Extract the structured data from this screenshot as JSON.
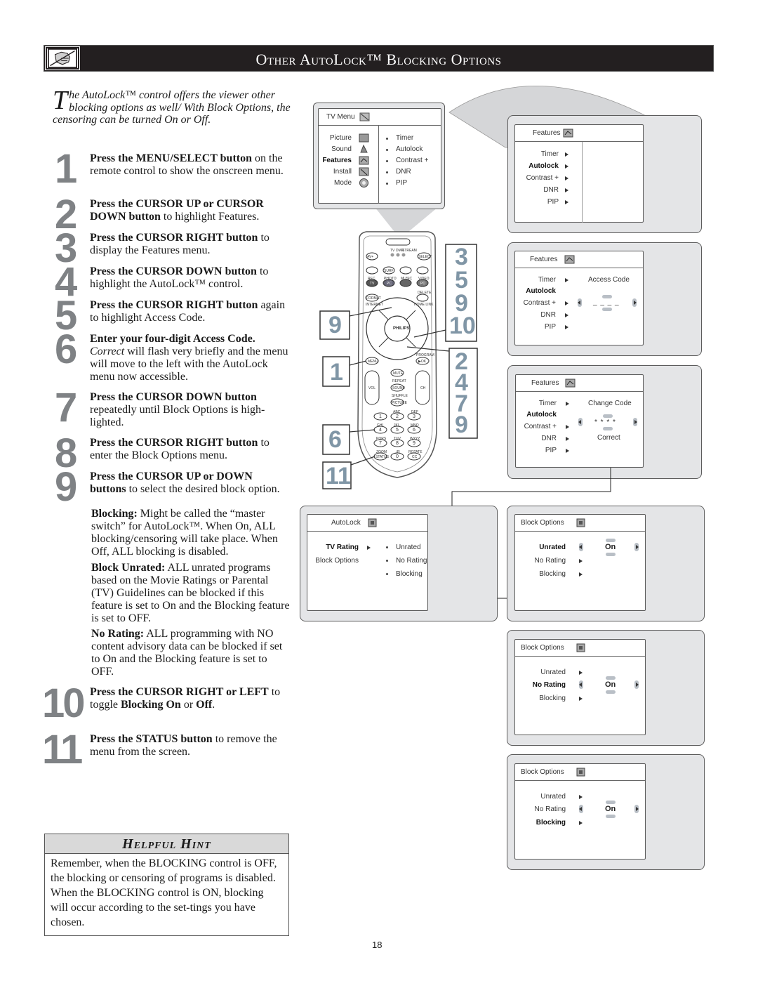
{
  "header": {
    "icon": "hand-pointing-icon",
    "title": "Other AutoLock™ Blocking Options"
  },
  "intro": {
    "dropcap": "T",
    "text": "he AutoLock™ control offers the viewer other blocking options as well/ With Block Options, the censoring can be turned On or Off."
  },
  "steps": [
    {
      "number": "1",
      "bold": "Press the MENU/SELECT button",
      "rest": " on the remote control to show the onscreen menu."
    },
    {
      "number": "2",
      "bold": "Press the CURSOR UP or CURSOR DOWN button",
      "rest": " to highlight Features."
    },
    {
      "number": "3",
      "bold": "Press the CURSOR RIGHT button",
      "rest": " to display the Features menu."
    },
    {
      "number": "4",
      "bold": "Press the CURSOR DOWN button",
      "rest": " to highlight the AutoLock™ control."
    },
    {
      "number": "5",
      "bold": "Press the CURSOR RIGHT button",
      "rest": " again to highlight Access Code."
    },
    {
      "number": "6",
      "bold": "Enter your four-digit Access Code.",
      "rest_italic": "Correct",
      "rest": " will flash very briefly and the menu will move to the left with the AutoLock menu now accessible."
    },
    {
      "number": "7",
      "bold": "Press the CURSOR DOWN button",
      "rest": " repeatedly until Block Options is high-lighted."
    },
    {
      "number": "8",
      "bold": "Press the CURSOR RIGHT button",
      "rest": " to enter the Block Options menu."
    },
    {
      "number": "9",
      "bold": "Press the CURSOR UP or DOWN buttons",
      "rest": " to select the desired block option."
    },
    {
      "number": "10",
      "bold": "Press the CURSOR RIGHT or LEFT",
      "rest": " to toggle ",
      "bold2": "Blocking On",
      "rest2": " or ",
      "bold3": "Off",
      "rest3": "."
    },
    {
      "number": "11",
      "bold": "Press the STATUS button",
      "rest": " to remove the menu from the screen."
    }
  ],
  "definitions": [
    {
      "term": "Blocking:",
      "text": " Might be called the “master switch” for AutoLock™. When On, ALL blocking/censoring will take place. When Off, ALL blocking is disabled."
    },
    {
      "term": "Block Unrated:",
      "text": " ALL unrated programs based on the Movie Ratings or Parental (TV) Guidelines can be blocked if this feature is set to On and the Blocking feature is set to OFF."
    },
    {
      "term": "No Rating:",
      "text": " ALL programming with NO content advisory data can be blocked if set to On and the Blocking feature is set to OFF."
    }
  ],
  "hint": {
    "title": "Helpful Hint",
    "text": "Remember, when the BLOCKING control is OFF, the blocking or censoring of programs is disabled. When the BLOCKING control is ON, blocking will occur according to the set-tings you have chosen."
  },
  "page_number": "18",
  "screens": {
    "tv_menu": {
      "title": "TV Menu",
      "left_items": [
        "Picture",
        "Sound",
        "Features",
        "Install",
        "Mode"
      ],
      "selected": "Features",
      "right_items": [
        "Timer",
        "Autolock",
        "Contrast +",
        "DNR",
        "PIP"
      ]
    },
    "features_1": {
      "title": "Features",
      "items": [
        "Timer",
        "Autolock",
        "Contrast +",
        "DNR",
        "PIP"
      ],
      "selected": "Autolock"
    },
    "features_2": {
      "title": "Features",
      "items": [
        "Timer",
        "Autolock",
        "Contrast +",
        "DNR",
        "PIP"
      ],
      "selected": "Autolock",
      "field_label": "Access Code",
      "field_value": "_ _ _ _"
    },
    "features_3": {
      "title": "Features",
      "items": [
        "Timer",
        "Autolock",
        "Contrast +",
        "DNR",
        "PIP"
      ],
      "selected": "Autolock",
      "field_label": "Change Code",
      "field_value": "* * * *",
      "status": "Correct"
    },
    "autolock": {
      "title": "AutoLock",
      "left_items": [
        "TV Rating",
        "Block Options"
      ],
      "selected": "TV Rating",
      "right_items": [
        "Unrated",
        "No Rating",
        "Blocking"
      ]
    },
    "block_options_1": {
      "title": "Block Options",
      "items": [
        "Unrated",
        "No Rating",
        "Blocking"
      ],
      "selected": "Unrated",
      "value": "On"
    },
    "block_options_2": {
      "title": "Block Options",
      "items": [
        "Unrated",
        "No Rating",
        "Blocking"
      ],
      "selected": "No Rating",
      "value": "On"
    },
    "block_options_3": {
      "title": "Block Options",
      "items": [
        "Unrated",
        "No Rating",
        "Blocking"
      ],
      "selected": "Blocking",
      "value": "On"
    }
  },
  "remote": {
    "brand": "PHILIPS",
    "top_labels": [
      "TV",
      "DMR",
      "STREAM"
    ],
    "buttons_row1": [
      "AV+",
      "SELECT"
    ],
    "buttons_row2_labels": [
      "▶II",
      "■",
      "I◀◀",
      "▶▶I"
    ],
    "buttons_row2": [
      "",
      "SURF",
      "",
      ""
    ],
    "buttons_row3_labels": [
      "REC",
      "PHOTO",
      "MUSIC",
      "VIDEO"
    ],
    "buttons_row3": [
      "TV",
      "PC",
      "",
      "PO"
    ],
    "format": "FORMAT",
    "internet": "INTERNET",
    "delete": "DELETE",
    "home_link": "HOME LINK",
    "menu": "MENU",
    "program": "PROGRAM",
    "ok": "▶OK",
    "mute": "MUTE",
    "repeat": "REPEAT",
    "sound": "SOUND",
    "shuffle": "SHUFFLE",
    "picture": "PICTURE",
    "vol": "VOL",
    "ch": "CH",
    "digits": [
      "1",
      "2",
      "3",
      "4",
      "5",
      "6",
      "7",
      "8",
      "9",
      "STATUS",
      "0",
      "CC"
    ],
    "digit_labels": [
      ".",
      "ABC",
      "DEF",
      "GHI",
      "JKL",
      "MNO",
      "PQRS",
      "TUV",
      "WXYZ",
      "ZOOM",
      "_/R",
      "ROTATE"
    ],
    "callouts": {
      "left_9": "9",
      "left_1": "1",
      "left_6": "6",
      "left_11": "11",
      "right_top": [
        "3",
        "5",
        "9",
        "10"
      ],
      "right_bottom": [
        "2",
        "4",
        "7",
        "9"
      ]
    }
  }
}
